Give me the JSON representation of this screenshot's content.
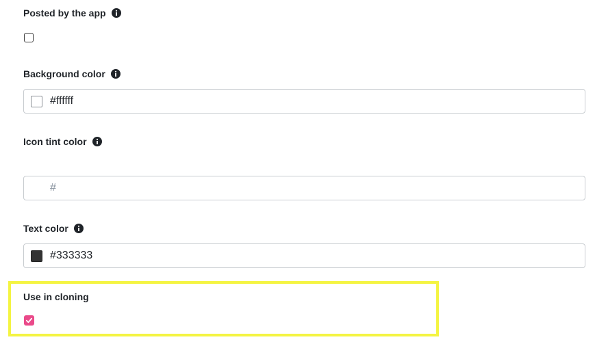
{
  "fields": {
    "posted_by_app": {
      "label": "Posted by the app",
      "checked": false,
      "icon": "info-icon"
    },
    "background_color": {
      "label": "Background color",
      "value": "#ffffff",
      "swatch": "#ffffff",
      "icon": "info-icon"
    },
    "icon_tint_color": {
      "label": "Icon tint color",
      "value": "",
      "placeholder": "#",
      "icon": "info-icon"
    },
    "text_color": {
      "label": "Text color",
      "value": "#333333",
      "swatch": "#333333",
      "icon": "info-icon"
    },
    "use_in_cloning": {
      "label": "Use in cloning",
      "checked": true
    }
  },
  "colors": {
    "checkbox_accent": "#ea4a8a",
    "highlight": "#f4f442"
  }
}
